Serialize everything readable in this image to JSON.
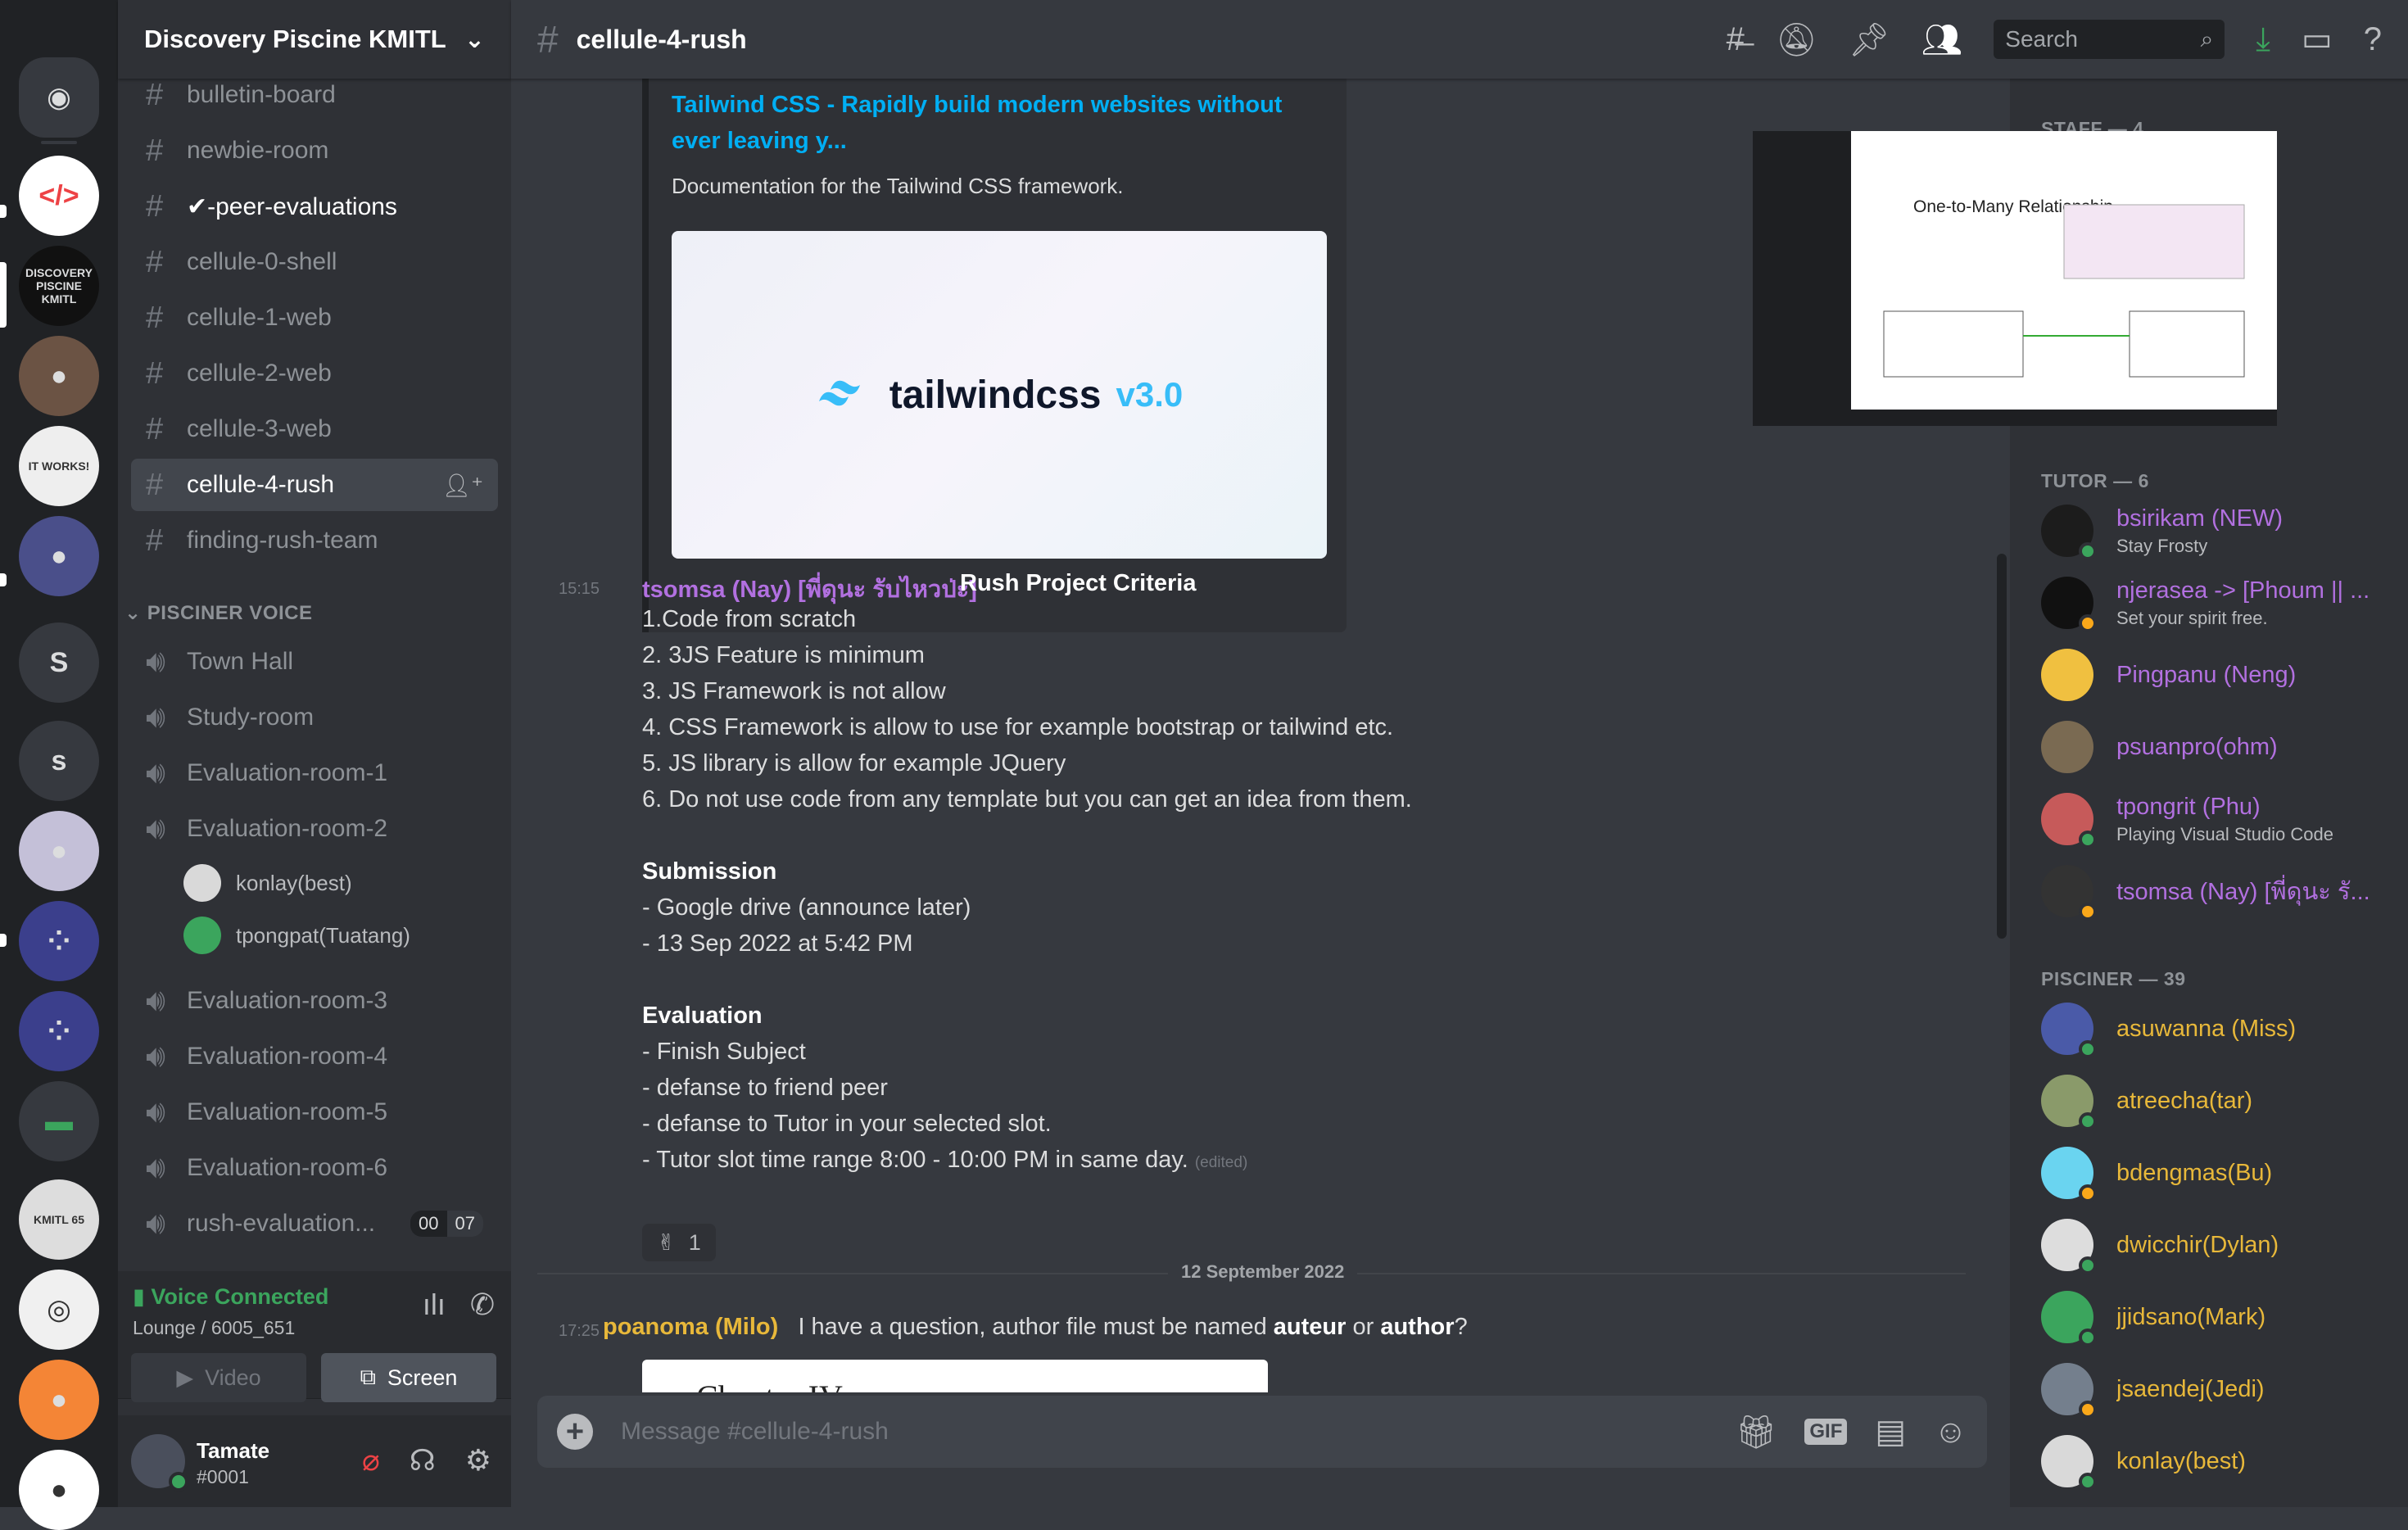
{
  "server": {
    "name": "Discovery Piscine KMITL",
    "chevron_icon": "chevron-down-icon"
  },
  "guilds": [
    {
      "name": "Home",
      "icon": "discord-logo-icon",
      "color": "#36393f"
    },
    {
      "name": "Code server",
      "icon": "code-brackets-icon",
      "color": "#ffffff"
    },
    {
      "name": "Discovery Piscine",
      "icon": "server-logo",
      "label": "DISCOVERY PISCINE KMITL",
      "color": "#111111"
    },
    {
      "name": "Server 3",
      "icon": "server-avatar",
      "color": "#6b5344"
    },
    {
      "name": "Programming server",
      "icon": "server-avatar",
      "label": "IT WORKS!",
      "color": "#eeeeee"
    },
    {
      "name": "Anime server",
      "icon": "server-avatar",
      "color": "#4a4f8a"
    },
    {
      "name": "S server 1",
      "label": "S",
      "color": "#36393f"
    },
    {
      "name": "S server 2",
      "label": "s",
      "color": "#36393f"
    },
    {
      "name": "Anime server 2",
      "icon": "server-avatar",
      "color": "#c4c0d8"
    },
    {
      "name": "Folder 1",
      "icon": "server-folder",
      "color": "#3b3f8c"
    },
    {
      "name": "Folder 2",
      "icon": "server-folder",
      "color": "#3b3f8c"
    },
    {
      "name": "Folder 3",
      "icon": "folder-icon",
      "color": "#36393f"
    },
    {
      "name": "KMITL 65",
      "label": "KMITL 65",
      "color": "#dddddd"
    },
    {
      "name": "S logo server",
      "icon": "server-logo",
      "color": "#f0f0f0"
    },
    {
      "name": "Orange server",
      "icon": "server-avatar",
      "color": "#f48536"
    },
    {
      "name": "Face server",
      "icon": "server-avatar",
      "color": "#ffffff"
    }
  ],
  "channels": [
    {
      "name": "bulletin-board",
      "state": "normal"
    },
    {
      "name": "newbie-room",
      "state": "normal"
    },
    {
      "name": "✔-peer-evaluations",
      "state": "unread"
    },
    {
      "name": "cellule-0-shell",
      "state": "normal"
    },
    {
      "name": "cellule-1-web",
      "state": "normal"
    },
    {
      "name": "cellule-2-web",
      "state": "normal"
    },
    {
      "name": "cellule-3-web",
      "state": "normal"
    },
    {
      "name": "cellule-4-rush",
      "state": "active"
    },
    {
      "name": "finding-rush-team",
      "state": "normal"
    }
  ],
  "voice_category": "PISCINER VOICE",
  "voice_channels": [
    {
      "name": "Town Hall"
    },
    {
      "name": "Study-room"
    },
    {
      "name": "Evaluation-room-1"
    },
    {
      "name": "Evaluation-room-2"
    },
    {
      "name": "Evaluation-room-3"
    },
    {
      "name": "Evaluation-room-4"
    },
    {
      "name": "Evaluation-room-5"
    },
    {
      "name": "Evaluation-room-6"
    },
    {
      "name": "rush-evaluation...",
      "badge": [
        "00",
        "07"
      ]
    }
  ],
  "voice_users": [
    {
      "name": "konlay(best)",
      "color": "#d9d9d9"
    },
    {
      "name": "tpongpat(Tuatang)",
      "color": "#3ba55d"
    }
  ],
  "voice_connection": {
    "status": "Voice Connected",
    "location": "Lounge / 6005_651",
    "video_label": "Video",
    "screen_label": "Screen"
  },
  "user": {
    "name": "Tamate",
    "tag": "#0001"
  },
  "topbar": {
    "channel": "cellule-4-rush",
    "search_placeholder": "Search"
  },
  "embed": {
    "title": "Tailwind CSS - Rapidly build modern websites without ever leaving y...",
    "description": "Documentation for the Tailwind CSS framework.",
    "image_text": "tailwindcss",
    "image_version": "v3.0"
  },
  "message1": {
    "time": "15:15",
    "author": "tsomsa (Nay) [พี่ดุนะ รับไหวป่ะ]",
    "author_color": "#b270e0",
    "lines": [
      {
        "text": "Rush Project Criteria",
        "bold": true,
        "inline": true
      },
      {
        "text": "1.Code from scratch"
      },
      {
        "text": "2. 3JS Feature is minimum"
      },
      {
        "text": "3. JS Framework is not allow"
      },
      {
        "text": "4. CSS Framework is allow to use for example bootstrap or tailwind etc."
      },
      {
        "text": "5. JS library is allow for example JQuery"
      },
      {
        "text": "6. Do not use code from any template but you can get an idea from them."
      },
      {
        "text": "Submission",
        "bold": true
      },
      {
        "text": "- Google drive (announce later)"
      },
      {
        "text": "- 13 Sep 2022 at 5:42 PM"
      },
      {
        "text": "Evaluation",
        "bold": true
      },
      {
        "text": "- Finish Subject"
      },
      {
        "text": "- defanse to friend peer"
      },
      {
        "text": "- defanse to Tutor in your selected slot."
      },
      {
        "text": "- Tutor slot time range 8:00 - 10:00 PM in same day."
      }
    ],
    "edited": "(edited)",
    "reaction": {
      "emoji": "✌",
      "count": "1"
    }
  },
  "date_divider": "12 September 2022",
  "message2": {
    "time": "17:25",
    "author": "poanoma (Milo)",
    "author_color": "#e8b83a",
    "text_before": "I have a question, author file must be named ",
    "bold1": "auteur",
    "text_mid": " or ",
    "bold2": "author",
    "text_after": "?",
    "attachment_text": "Chapter IV"
  },
  "composer": {
    "placeholder": "Message #cellule-4-rush",
    "gif_label": "GIF"
  },
  "stream_preview": {
    "title": "One-to-Many Relationship"
  },
  "members": {
    "staff_header": "STAFF — 4",
    "tutor_header": "TUTOR — 6",
    "tutors": [
      {
        "name": "bsirikam (NEW)",
        "sub": "Stay Frosty",
        "status": "online",
        "color": "#1c1c1c"
      },
      {
        "name": "njerasea -> [Phoum || ...",
        "sub": "Set your spirit free.",
        "status": "idle",
        "color": "#111111"
      },
      {
        "name": "Pingpanu (Neng)",
        "sub": "",
        "status": "none",
        "color": "#f0c040"
      },
      {
        "name": "psuanpro(ohm)",
        "sub": "",
        "status": "none",
        "color": "#7a6a52"
      },
      {
        "name": "tpongrit (Phu)",
        "sub": "Playing Visual Studio Code",
        "status": "online",
        "color": "#c65a5a"
      },
      {
        "name": "tsomsa (Nay) [พี่ดุนะ รั...",
        "sub": "",
        "status": "idle",
        "color": "#333333"
      }
    ],
    "piscine_header": "PISCINER — 39",
    "piscines": [
      {
        "name": "asuwanna (Miss)",
        "status": "mobile",
        "color": "#4a5aa8"
      },
      {
        "name": "atreecha(tar)",
        "status": "online",
        "color": "#8a9a6a"
      },
      {
        "name": "bdengmas(Bu)",
        "status": "idle",
        "color": "#6ad4f0"
      },
      {
        "name": "dwicchir(Dylan)",
        "status": "online",
        "color": "#dddddd"
      },
      {
        "name": "jjidsano(Mark)",
        "status": "mobile",
        "color": "#3ba55d"
      },
      {
        "name": "jsaendej(Jedi)",
        "status": "idle",
        "color": "#747f8d"
      },
      {
        "name": "konlay(best)",
        "status": "online",
        "color": "#d9d9d9"
      }
    ]
  }
}
